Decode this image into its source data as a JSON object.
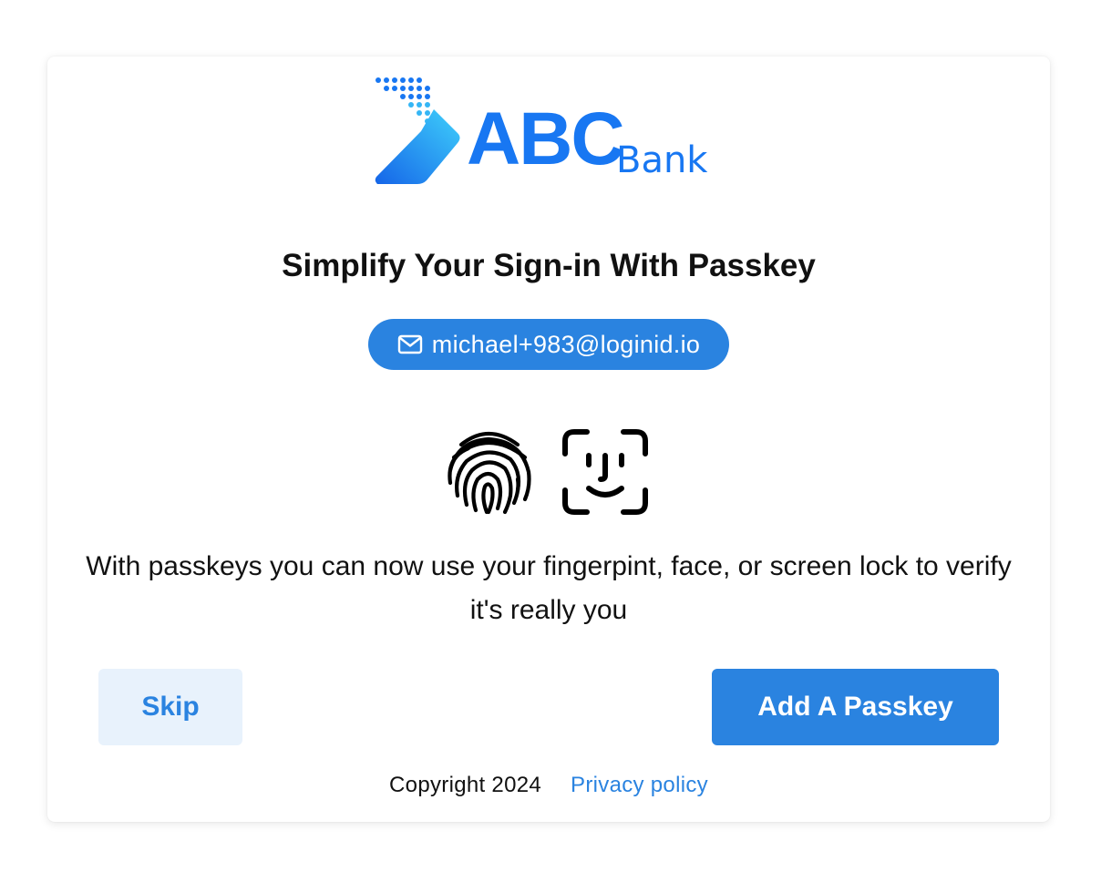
{
  "brand": {
    "logo_abc": "ABC",
    "logo_bank": "Bank",
    "color": "#1877f2"
  },
  "main": {
    "title": "Simplify Your Sign-in With Passkey",
    "email": "michael+983@loginid.io",
    "email_icon": "mail-icon",
    "biometric_icons": [
      "fingerprint-icon",
      "face-id-icon"
    ],
    "description": "With passkeys you can now use your fingerpint, face, or screen lock to verify it's really you"
  },
  "actions": {
    "skip_label": "Skip",
    "add_label": "Add A Passkey",
    "primary_color": "#2a83e0",
    "secondary_bg": "#e8f2fc"
  },
  "footer": {
    "copyright": "Copyright 2024",
    "privacy": "Privacy policy"
  }
}
